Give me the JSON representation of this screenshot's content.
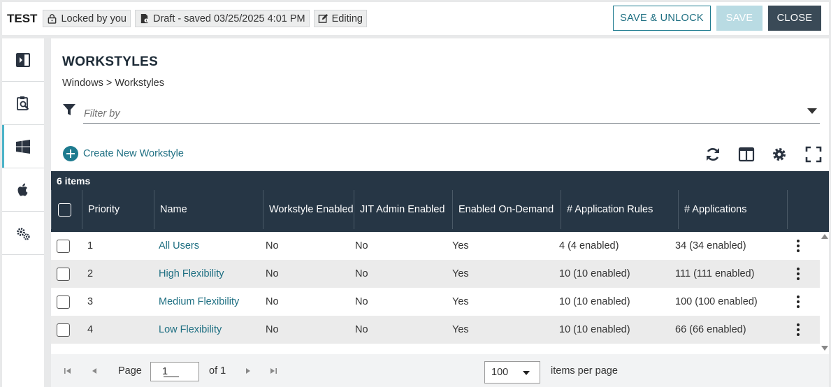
{
  "header": {
    "title": "TEST",
    "lock_status": "Locked by you",
    "draft_status": "Draft - saved 03/25/2025 4:01 PM",
    "mode": "Editing",
    "save_unlock_label": "SAVE & UNLOCK",
    "save_label": "SAVE",
    "close_label": "CLOSE"
  },
  "sidebar": {
    "items": [
      {
        "icon": "expand-panel-icon"
      },
      {
        "icon": "policy-search-icon"
      },
      {
        "icon": "windows-icon",
        "active": true
      },
      {
        "icon": "apple-icon"
      },
      {
        "icon": "gears-icon"
      }
    ]
  },
  "main": {
    "title": "WORKSTYLES",
    "breadcrumb": "Windows > Workstyles",
    "filter_placeholder": "Filter by",
    "create_label": "Create New Workstyle",
    "tools": [
      "refresh-icon",
      "columns-icon",
      "settings-icon",
      "fullscreen-icon"
    ]
  },
  "grid": {
    "item_count": "6 items",
    "columns": {
      "priority": "Priority",
      "name": "Name",
      "workstyle_enabled": "Workstyle Enabled",
      "jit_admin": "JIT Admin Enabled",
      "on_demand": "Enabled On-Demand",
      "app_rules": "# Application Rules",
      "applications": "# Applications"
    },
    "rows": [
      {
        "priority": "1",
        "name": "All Users",
        "workstyle_enabled": "No",
        "jit_admin": "No",
        "on_demand": "Yes",
        "app_rules": "4 (4 enabled)",
        "applications": "34 (34 enabled)"
      },
      {
        "priority": "2",
        "name": "High Flexibility",
        "workstyle_enabled": "No",
        "jit_admin": "No",
        "on_demand": "Yes",
        "app_rules": "10 (10 enabled)",
        "applications": "111 (111 enabled)"
      },
      {
        "priority": "3",
        "name": "Medium Flexibility",
        "workstyle_enabled": "No",
        "jit_admin": "No",
        "on_demand": "Yes",
        "app_rules": "10 (10 enabled)",
        "applications": "100 (100 enabled)"
      },
      {
        "priority": "4",
        "name": "Low Flexibility",
        "workstyle_enabled": "No",
        "jit_admin": "No",
        "on_demand": "Yes",
        "app_rules": "10 (10 enabled)",
        "applications": "66 (66 enabled)"
      }
    ]
  },
  "pager": {
    "page_label": "Page",
    "page_value": "1",
    "of_label": "of 1",
    "per_page_value": "100",
    "per_page_label": "items per page"
  }
}
